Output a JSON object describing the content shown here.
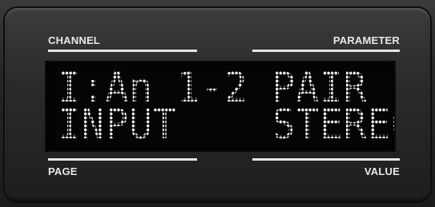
{
  "labels": {
    "channel": "CHANNEL",
    "parameter": "PARAMETER",
    "page": "PAGE",
    "value": "VALUE"
  },
  "display": {
    "line1": "I:An 1-2 PAIR",
    "line2": "INPUT    STEREO"
  },
  "colors": {
    "panel": "#262626",
    "screen": "#050505",
    "text": "#f2f2f2",
    "labels": "#e8e8e8"
  }
}
